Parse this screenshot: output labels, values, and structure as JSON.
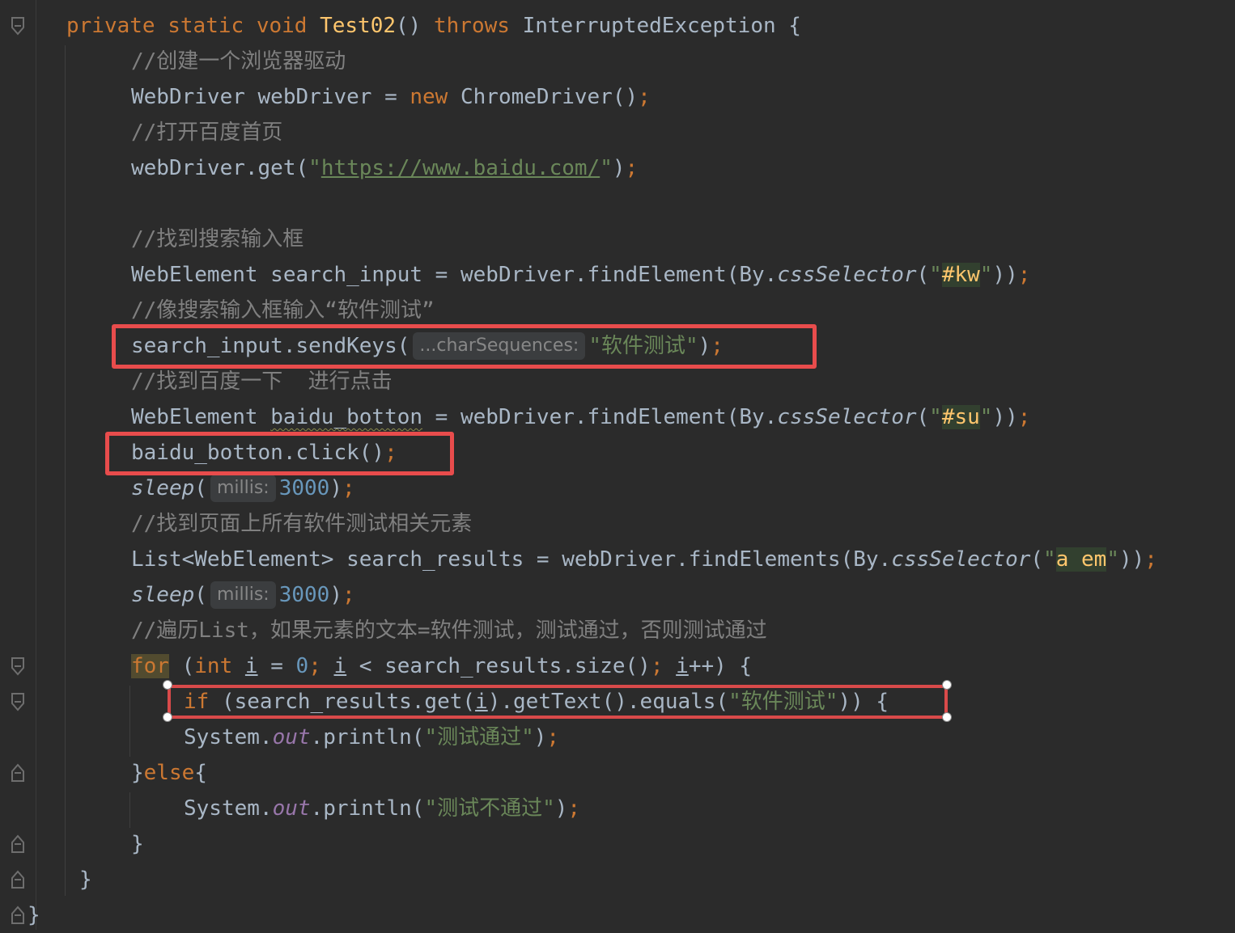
{
  "editor": {
    "lines": {
      "method_sig": {
        "mod1": "private",
        "mod2": "static",
        "ret": "void",
        "name": "Test02",
        "parens": "()",
        "throws": "throws",
        "exc": "InterruptedException",
        "brace": "{"
      },
      "c1": "//创建一个浏览器驱动",
      "l_driver": {
        "type": "WebDriver webDriver = ",
        "new": "new",
        "ctor": " ChromeDriver()",
        "semi": ";"
      },
      "c2": "//打开百度首页",
      "l_get": {
        "pre": "webDriver.get(",
        "q1": "\"",
        "url": "https://www.baidu.com/",
        "q2": "\"",
        "post": ")",
        "semi": ";"
      },
      "c3": "//找到搜索输入框",
      "l_find1": {
        "pre": "WebElement search_input = webDriver.findElement(By.",
        "method": "cssSelector",
        "open": "(",
        "q1": "\"",
        "sel": "#kw",
        "q2": "\"",
        "close": "))",
        "semi": ";"
      },
      "c4": "//像搜索输入框输入“软件测试”",
      "l_send": {
        "pre": "search_input.sendKeys(",
        "hint": "...charSequences:",
        "str": "\"软件测试\"",
        "close": ")",
        "semi": ";"
      },
      "c5": "//找到百度一下  进行点击",
      "l_find2": {
        "pre": "WebElement ",
        "var": "baidu_botton",
        "mid": " = webDriver.findElement(By.",
        "method": "cssSelector",
        "open": "(",
        "q1": "\"",
        "sel": "#su",
        "q2": "\"",
        "close": "))",
        "semi": ";"
      },
      "l_click": {
        "code": "baidu_botton.click()",
        "semi": ";"
      },
      "l_sleep1": {
        "fn": "sleep",
        "open": "(",
        "hint": "millis:",
        "num": "3000",
        "close": ")",
        "semi": ";"
      },
      "c6": "//找到页面上所有软件测试相关元素",
      "l_list": {
        "pre": "List<WebElement> search_results = webDriver.findElements(By.",
        "method": "cssSelector",
        "open": "(",
        "q1": "\"",
        "sel": "a em",
        "q2": "\"",
        "close": "))",
        "semi": ";"
      },
      "l_sleep2": {
        "fn": "sleep",
        "open": "(",
        "hint": "millis:",
        "num": "3000",
        "close": ")",
        "semi": ";"
      },
      "c7": "//遍历List，如果元素的文本=软件测试，测试通过，否则测试通过",
      "l_for": {
        "for": "for",
        "open": " (",
        "int": "int",
        "sp": " ",
        "i1": "i",
        "eq": " = ",
        "zero": "0",
        "semi1": ";",
        "sp2": " ",
        "i2": "i",
        "lt": " < search_results.size()",
        "semi2": ";",
        "sp3": " ",
        "i3": "i",
        "inc": "++) {"
      },
      "l_if": {
        "if": "if",
        "pre": " (search_results.get(",
        "i": "i",
        "mid": ").getText().equals(",
        "str": "\"软件测试\"",
        "close": ")) {"
      },
      "l_print1": {
        "pre": "System.",
        "out": "out",
        "mid": ".println(",
        "str": "\"测试通过\"",
        "close": ")",
        "semi": ";"
      },
      "l_else": {
        "brace1": "}",
        "else": "else",
        "brace2": "{"
      },
      "l_print2": {
        "pre": "System.",
        "out": "out",
        "mid": ".println(",
        "str": "\"测试不通过\"",
        "close": ")",
        "semi": ";"
      },
      "l_close1": "}",
      "l_close2": "}",
      "l_close3": "}"
    }
  }
}
